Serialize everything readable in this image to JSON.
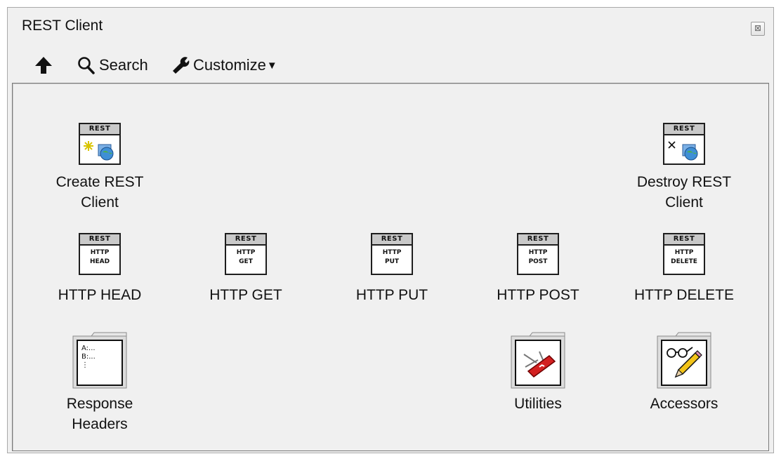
{
  "window": {
    "title": "REST Client",
    "close_glyph": "⊠"
  },
  "toolbar": {
    "up_icon": "arrow-up-icon",
    "search_label": "Search",
    "customize_label": "Customize",
    "customize_caret": "▼"
  },
  "items": {
    "create_rest_client": {
      "line1": "Create REST",
      "line2": "Client",
      "badge": "REST"
    },
    "destroy_rest_client": {
      "line1": "Destroy REST",
      "line2": "Client",
      "badge": "REST"
    },
    "http_head": {
      "label": "HTTP HEAD",
      "badge": "REST",
      "line1": "HTTP",
      "line2": "HEAD"
    },
    "http_get": {
      "label": "HTTP GET",
      "badge": "REST",
      "line1": "HTTP",
      "line2": "GET"
    },
    "http_put": {
      "label": "HTTP PUT",
      "badge": "REST",
      "line1": "HTTP",
      "line2": "PUT"
    },
    "http_post": {
      "label": "HTTP POST",
      "badge": "REST",
      "line1": "HTTP",
      "line2": "POST"
    },
    "http_delete": {
      "label": "HTTP DELETE",
      "badge": "REST",
      "line1": "HTTP",
      "line2": "DELETE"
    },
    "response_headers": {
      "line1": "Response",
      "line2": "Headers",
      "icon_lines": [
        "A:...",
        "B:...",
        "⋮"
      ]
    },
    "utilities": {
      "label": "Utilities"
    },
    "accessors": {
      "label": "Accessors"
    }
  }
}
